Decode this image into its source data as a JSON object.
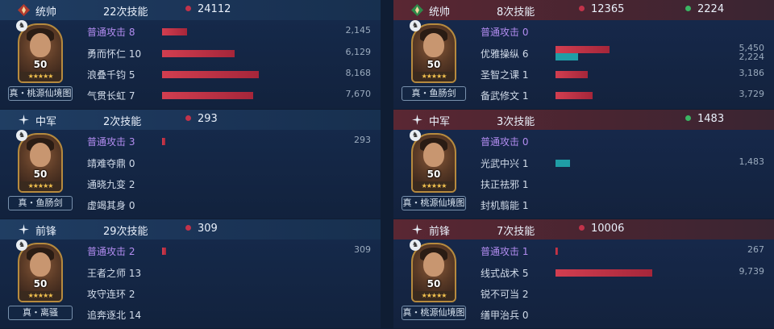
{
  "colors": {
    "damage_bar": "#d23e50",
    "heal_bar": "#1f9ea6",
    "purple_skill": "#b28cf0"
  },
  "left": [
    {
      "role": "统帅",
      "skill_count": "22次技能",
      "damage": "24112",
      "heal": "",
      "level": "50",
      "stars": "★★★★★",
      "weapon": "真・桃源仙境图",
      "skills": [
        {
          "name": "普通攻击",
          "count": "8",
          "damage": "2,145",
          "damage_frac": 0.26,
          "heal": "",
          "heal_frac": 0,
          "purple": true
        },
        {
          "name": "勇而怀仁",
          "count": "10",
          "damage": "6,129",
          "damage_frac": 0.75,
          "heal": "",
          "heal_frac": 0
        },
        {
          "name": "浪叠千钧",
          "count": "5",
          "damage": "8,168",
          "damage_frac": 1.0,
          "heal": "",
          "heal_frac": 0
        },
        {
          "name": "气贯长虹",
          "count": "7",
          "damage": "7,670",
          "damage_frac": 0.94,
          "heal": "",
          "heal_frac": 0
        }
      ]
    },
    {
      "role": "中军",
      "skill_count": "2次技能",
      "damage": "293",
      "heal": "",
      "level": "50",
      "stars": "★★★★★",
      "weapon": "真・鱼肠剑",
      "skills": [
        {
          "name": "普通攻击",
          "count": "3",
          "damage": "293",
          "damage_frac": 0.036,
          "heal": "",
          "heal_frac": 0,
          "purple": true
        },
        {
          "name": "靖难夺鼎",
          "count": "0",
          "damage": "",
          "damage_frac": 0,
          "heal": "",
          "heal_frac": 0
        },
        {
          "name": "通晓九变",
          "count": "2",
          "damage": "",
          "damage_frac": 0,
          "heal": "",
          "heal_frac": 0
        },
        {
          "name": "虚竭其身",
          "count": "0",
          "damage": "",
          "damage_frac": 0,
          "heal": "",
          "heal_frac": 0
        }
      ]
    },
    {
      "role": "前锋",
      "skill_count": "29次技能",
      "damage": "309",
      "heal": "",
      "level": "50",
      "stars": "★★★★★",
      "weapon": "真・离骚",
      "skills": [
        {
          "name": "普通攻击",
          "count": "2",
          "damage": "309",
          "damage_frac": 0.038,
          "heal": "",
          "heal_frac": 0,
          "purple": true
        },
        {
          "name": "王者之师",
          "count": "13",
          "damage": "",
          "damage_frac": 0,
          "heal": "",
          "heal_frac": 0
        },
        {
          "name": "攻守连环",
          "count": "2",
          "damage": "",
          "damage_frac": 0,
          "heal": "",
          "heal_frac": 0
        },
        {
          "name": "追奔逐北",
          "count": "14",
          "damage": "",
          "damage_frac": 0,
          "heal": "",
          "heal_frac": 0
        }
      ]
    }
  ],
  "right": [
    {
      "role": "统帅",
      "skill_count": "8次技能",
      "damage": "12365",
      "heal": "2224",
      "level": "50",
      "stars": "★★★★★",
      "weapon": "真・鱼肠剑",
      "skills": [
        {
          "name": "普通攻击",
          "count": "0",
          "damage": "",
          "damage_frac": 0,
          "heal": "",
          "heal_frac": 0,
          "purple": true
        },
        {
          "name": "优雅操纵",
          "count": "6",
          "damage": "5,450",
          "damage_frac": 0.56,
          "heal": "2,224",
          "heal_frac": 0.23
        },
        {
          "name": "圣智之课",
          "count": "1",
          "damage": "3,186",
          "damage_frac": 0.33,
          "heal": "",
          "heal_frac": 0
        },
        {
          "name": "备武修文",
          "count": "1",
          "damage": "3,729",
          "damage_frac": 0.38,
          "heal": "",
          "heal_frac": 0
        }
      ]
    },
    {
      "role": "中军",
      "skill_count": "3次技能",
      "damage": "",
      "heal": "1483",
      "level": "50",
      "stars": "★★★★★",
      "weapon": "真・桃源仙境图",
      "skills": [
        {
          "name": "普通攻击",
          "count": "0",
          "damage": "",
          "damage_frac": 0,
          "heal": "",
          "heal_frac": 0,
          "purple": true
        },
        {
          "name": "光武中兴",
          "count": "1",
          "damage": "",
          "damage_frac": 0,
          "heal": "1,483",
          "heal_frac": 0.15
        },
        {
          "name": "扶正祛邪",
          "count": "1",
          "damage": "",
          "damage_frac": 0,
          "heal": "",
          "heal_frac": 0
        },
        {
          "name": "封机翦能",
          "count": "1",
          "damage": "",
          "damage_frac": 0,
          "heal": "",
          "heal_frac": 0
        }
      ]
    },
    {
      "role": "前锋",
      "skill_count": "7次技能",
      "damage": "10006",
      "heal": "",
      "level": "50",
      "stars": "★★★★★",
      "weapon": "真・桃源仙境图",
      "skills": [
        {
          "name": "普通攻击",
          "count": "1",
          "damage": "267",
          "damage_frac": 0.027,
          "heal": "",
          "heal_frac": 0,
          "purple": true
        },
        {
          "name": "线式战术",
          "count": "5",
          "damage": "9,739",
          "damage_frac": 1.0,
          "heal": "",
          "heal_frac": 0
        },
        {
          "name": "锐不可当",
          "count": "2",
          "damage": "",
          "damage_frac": 0,
          "heal": "",
          "heal_frac": 0
        },
        {
          "name": "缮甲治兵",
          "count": "0",
          "damage": "",
          "damage_frac": 0,
          "heal": "",
          "heal_frac": 0
        }
      ]
    }
  ]
}
